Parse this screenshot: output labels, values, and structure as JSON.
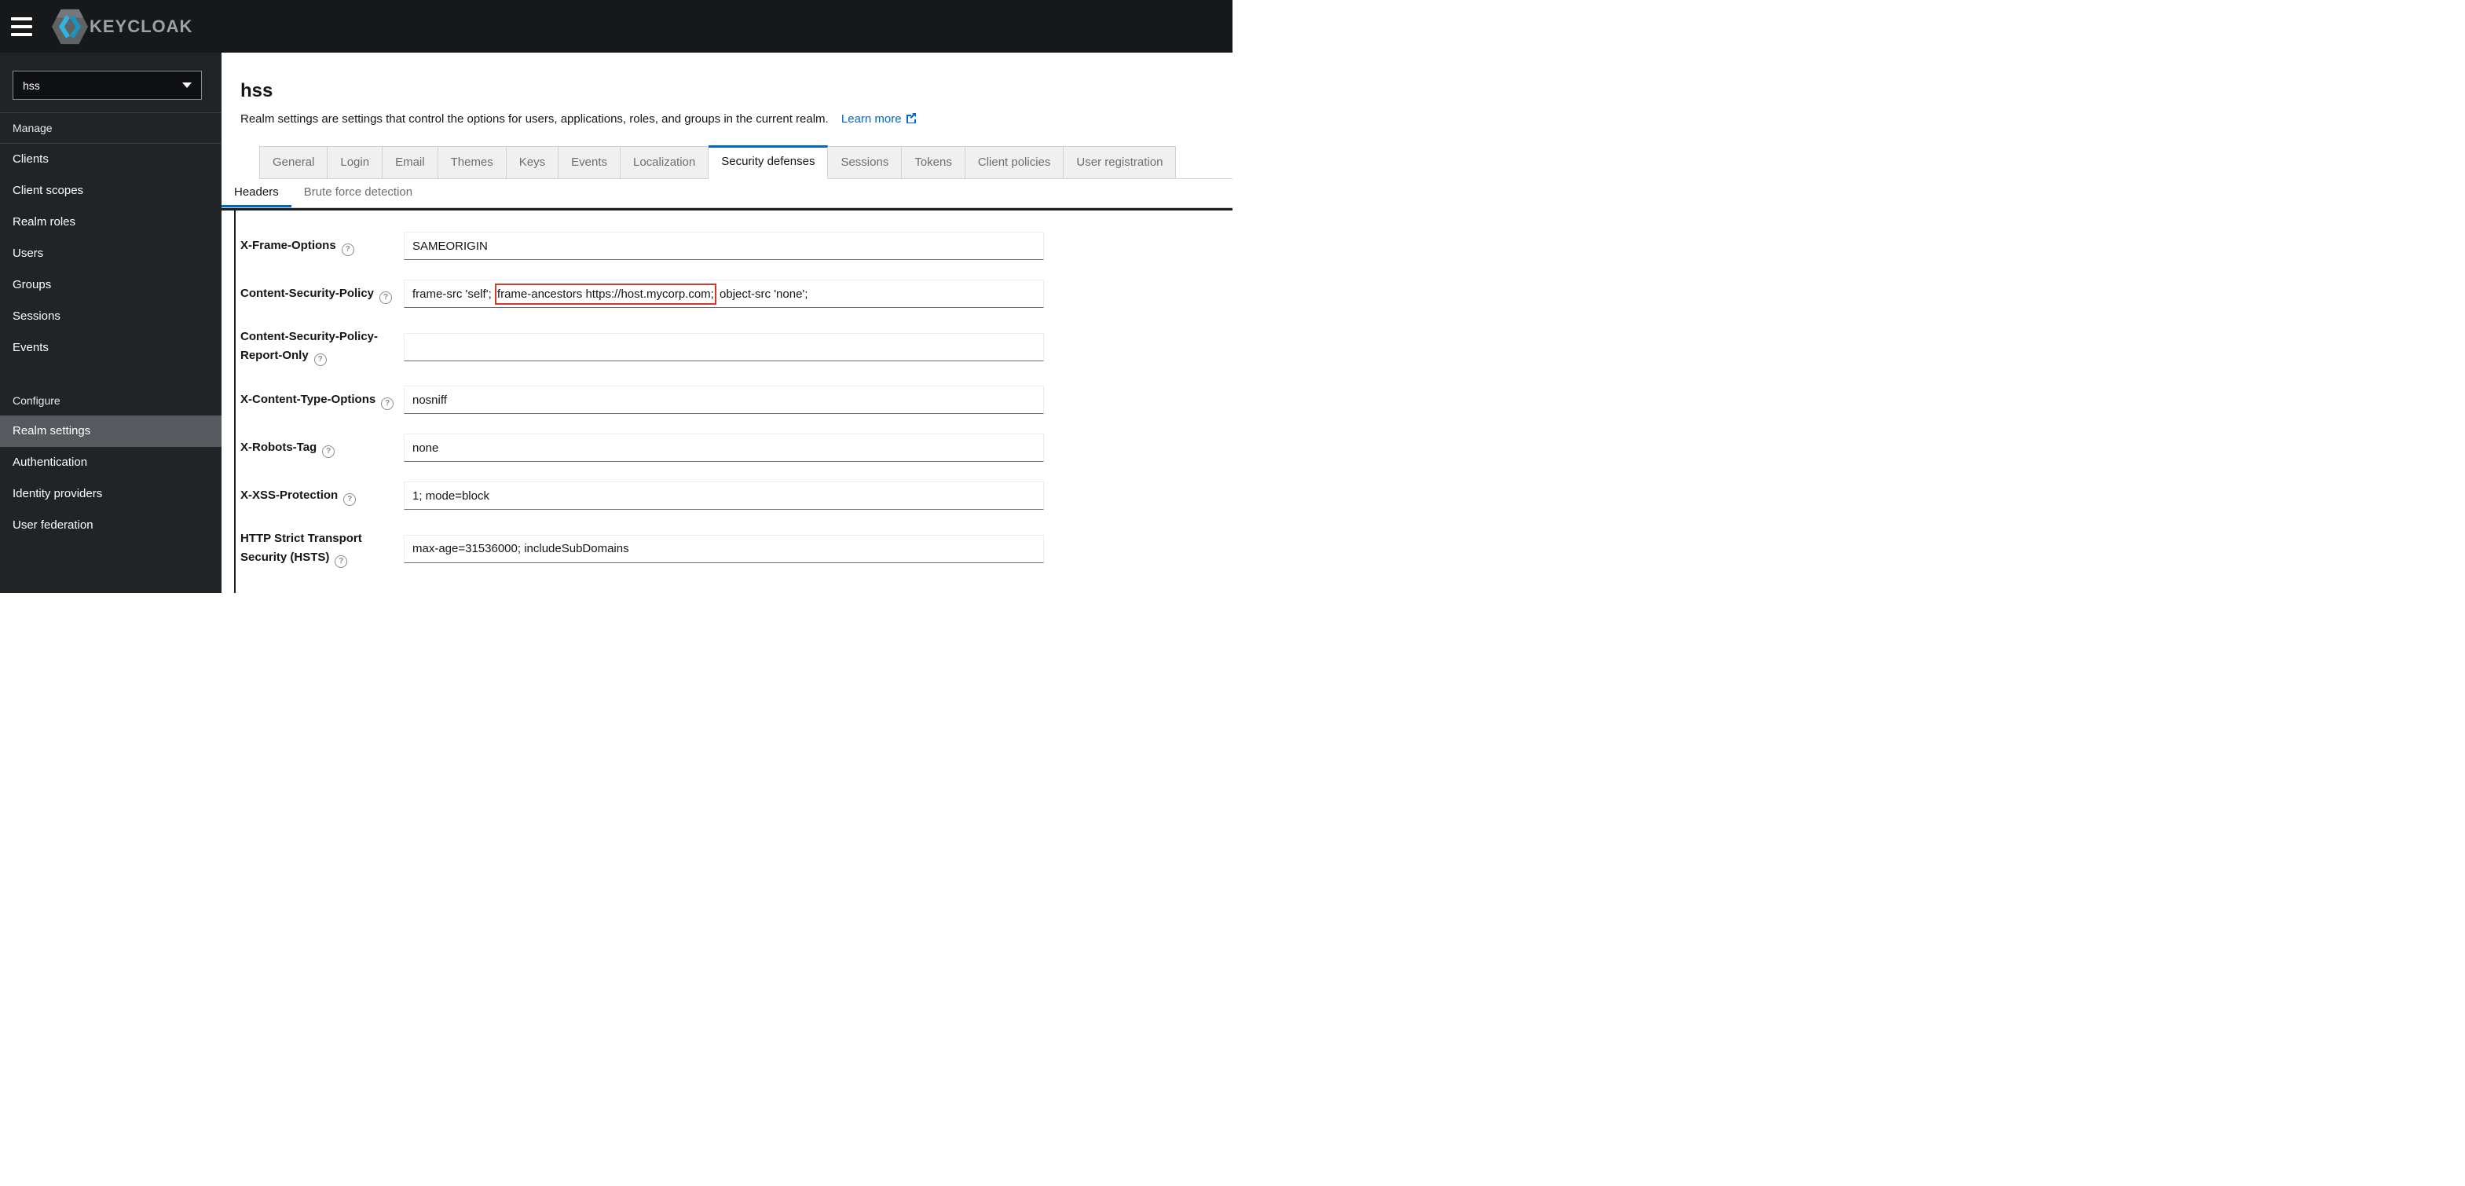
{
  "topbar": {
    "logo_text": "KEYCLOAK"
  },
  "sidebar": {
    "realm": "hss",
    "manage_label": "Manage",
    "manage_items": [
      "Clients",
      "Client scopes",
      "Realm roles",
      "Users",
      "Groups",
      "Sessions",
      "Events"
    ],
    "configure_label": "Configure",
    "configure_items": [
      "Realm settings",
      "Authentication",
      "Identity providers",
      "User federation"
    ],
    "active_item": "Realm settings"
  },
  "header": {
    "title": "hss",
    "description": "Realm settings are settings that control the options for users, applications, roles, and groups in the current realm.",
    "learn_more": "Learn more"
  },
  "tabs": {
    "items": [
      "General",
      "Login",
      "Email",
      "Themes",
      "Keys",
      "Events",
      "Localization",
      "Security defenses",
      "Sessions",
      "Tokens",
      "Client policies",
      "User registration"
    ],
    "active": "Security defenses"
  },
  "subtabs": {
    "items": [
      "Headers",
      "Brute force detection"
    ],
    "active": "Headers"
  },
  "form": {
    "fields": [
      {
        "label": "X-Frame-Options",
        "value": "SAMEORIGIN"
      },
      {
        "label": "Content-Security-Policy",
        "value_prefix": "frame-src 'self'; ",
        "value_highlight": "frame-ancestors https://host.mycorp.com;",
        "value_suffix": " object-src 'none';"
      },
      {
        "label": "Content-Security-Policy-Report-Only",
        "value": ""
      },
      {
        "label": "X-Content-Type-Options",
        "value": "nosniff"
      },
      {
        "label": "X-Robots-Tag",
        "value": "none"
      },
      {
        "label": "X-XSS-Protection",
        "value": "1; mode=block"
      },
      {
        "label": "HTTP Strict Transport Security (HSTS)",
        "value": "max-age=31536000; includeSubDomains"
      }
    ]
  },
  "icons": {
    "help": "?"
  },
  "colors": {
    "accent_blue": "#0066cc",
    "annotation_red": "#d4372c",
    "logo_blue": "#2fb4e0",
    "topbar_bg": "#17181a",
    "sidebar_bg": "#212427",
    "active_nav_bg": "#565a5e"
  }
}
